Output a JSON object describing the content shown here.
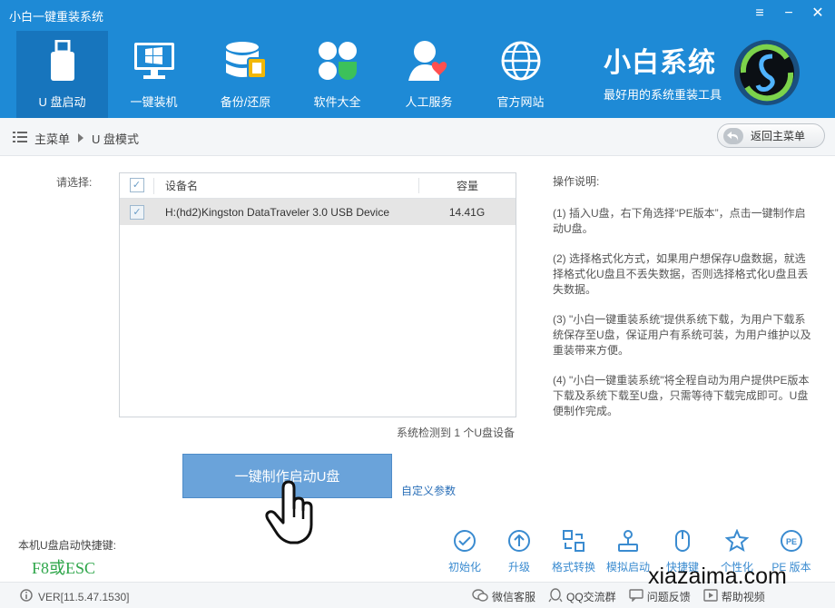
{
  "window": {
    "title": "小白一键重装系统",
    "controls": {
      "menu": "≡",
      "minimize": "−",
      "close": "✕"
    }
  },
  "nav": {
    "items": [
      {
        "label": "U 盘启动",
        "icon": "usb-drive-icon",
        "active": true
      },
      {
        "label": "一键装机",
        "icon": "monitor-windows-icon",
        "active": false
      },
      {
        "label": "备份/还原",
        "icon": "database-backup-icon",
        "active": false
      },
      {
        "label": "软件大全",
        "icon": "apps-grid-icon",
        "active": false
      },
      {
        "label": "人工服务",
        "icon": "user-support-icon",
        "active": false
      },
      {
        "label": "官方网站",
        "icon": "globe-icon",
        "active": false
      }
    ]
  },
  "brand": {
    "name": "小白系统",
    "slogan": "最好用的系统重装工具"
  },
  "breadcrumb": {
    "root": "主菜单",
    "current": "U 盘模式"
  },
  "back_button": {
    "label": "返回主菜单"
  },
  "device_select": {
    "label": "请选择:",
    "columns": {
      "name": "设备名",
      "capacity": "容量"
    },
    "devices": [
      {
        "name": "H:(hd2)Kingston DataTraveler 3.0 USB Device",
        "capacity": "14.41G",
        "checked": true
      }
    ],
    "status": "系统检测到 1 个U盘设备"
  },
  "actions": {
    "make_boot_disk": "一键制作启动U盘",
    "custom_params": "自定义参数"
  },
  "instructions": {
    "title": "操作说明:",
    "steps": [
      "(1) 插入U盘，右下角选择“PE版本”，点击一键制作启动U盘。",
      "(2) 选择格式化方式，如果用户想保存U盘数据，就选择格式化U盘且不丢失数据，否则选择格式化U盘且丢失数据。",
      "(3) \"小白一键重装系统\"提供系统下载，为用户下载系统保存至U盘，保证用户有系统可装，为用户维护以及重装带来方便。",
      "(4) \"小白一键重装系统\"将全程自动为用户提供PE版本下载及系统下载至U盘，只需等待下载完成即可。U盘便制作完成。"
    ]
  },
  "hotkey": {
    "label": "本机U盘启动快捷键:",
    "value": "F8或ESC"
  },
  "tools": [
    {
      "label": "初始化",
      "icon": "check-circle-icon"
    },
    {
      "label": "升级",
      "icon": "upgrade-arrow-icon"
    },
    {
      "label": "格式转换",
      "icon": "format-convert-icon"
    },
    {
      "label": "模拟启动",
      "icon": "joystick-icon"
    },
    {
      "label": "快捷键",
      "icon": "mouse-icon"
    },
    {
      "label": "个性化",
      "icon": "star-customize-icon"
    },
    {
      "label": "PE 版本",
      "icon": "pe-badge-icon"
    }
  ],
  "footer": {
    "version": "VER[11.5.47.1530]",
    "links": [
      {
        "label": "微信客服",
        "icon": "wechat-icon"
      },
      {
        "label": "QQ交流群",
        "icon": "qq-icon"
      },
      {
        "label": "问题反馈",
        "icon": "feedback-icon"
      },
      {
        "label": "帮助视频",
        "icon": "help-video-icon"
      }
    ]
  },
  "watermark": "xiazaima.com",
  "colors": {
    "header_bg": "#1e8ad6",
    "nav_active_bg": "#1775bd",
    "primary_button": "#6aa3da",
    "hotkey_green": "#2ea64a",
    "link_blue": "#2a6fb8"
  }
}
